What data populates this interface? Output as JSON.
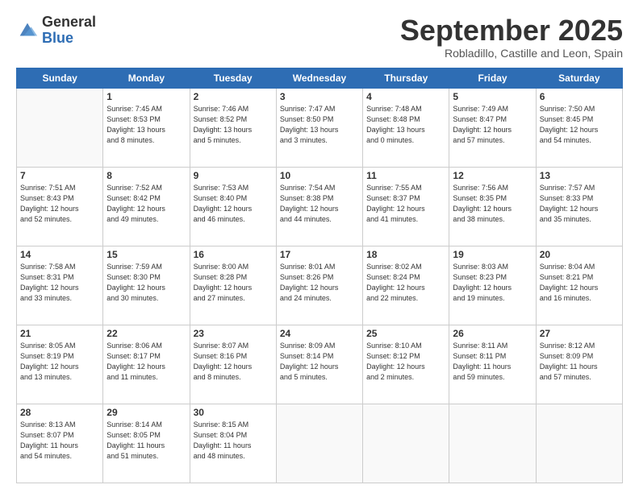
{
  "logo": {
    "general": "General",
    "blue": "Blue"
  },
  "title": "September 2025",
  "location": "Robladillo, Castille and Leon, Spain",
  "days_of_week": [
    "Sunday",
    "Monday",
    "Tuesday",
    "Wednesday",
    "Thursday",
    "Friday",
    "Saturday"
  ],
  "weeks": [
    [
      {
        "day": null,
        "info": null
      },
      {
        "day": "1",
        "info": "Sunrise: 7:45 AM\nSunset: 8:53 PM\nDaylight: 13 hours\nand 8 minutes."
      },
      {
        "day": "2",
        "info": "Sunrise: 7:46 AM\nSunset: 8:52 PM\nDaylight: 13 hours\nand 5 minutes."
      },
      {
        "day": "3",
        "info": "Sunrise: 7:47 AM\nSunset: 8:50 PM\nDaylight: 13 hours\nand 3 minutes."
      },
      {
        "day": "4",
        "info": "Sunrise: 7:48 AM\nSunset: 8:48 PM\nDaylight: 13 hours\nand 0 minutes."
      },
      {
        "day": "5",
        "info": "Sunrise: 7:49 AM\nSunset: 8:47 PM\nDaylight: 12 hours\nand 57 minutes."
      },
      {
        "day": "6",
        "info": "Sunrise: 7:50 AM\nSunset: 8:45 PM\nDaylight: 12 hours\nand 54 minutes."
      }
    ],
    [
      {
        "day": "7",
        "info": "Sunrise: 7:51 AM\nSunset: 8:43 PM\nDaylight: 12 hours\nand 52 minutes."
      },
      {
        "day": "8",
        "info": "Sunrise: 7:52 AM\nSunset: 8:42 PM\nDaylight: 12 hours\nand 49 minutes."
      },
      {
        "day": "9",
        "info": "Sunrise: 7:53 AM\nSunset: 8:40 PM\nDaylight: 12 hours\nand 46 minutes."
      },
      {
        "day": "10",
        "info": "Sunrise: 7:54 AM\nSunset: 8:38 PM\nDaylight: 12 hours\nand 44 minutes."
      },
      {
        "day": "11",
        "info": "Sunrise: 7:55 AM\nSunset: 8:37 PM\nDaylight: 12 hours\nand 41 minutes."
      },
      {
        "day": "12",
        "info": "Sunrise: 7:56 AM\nSunset: 8:35 PM\nDaylight: 12 hours\nand 38 minutes."
      },
      {
        "day": "13",
        "info": "Sunrise: 7:57 AM\nSunset: 8:33 PM\nDaylight: 12 hours\nand 35 minutes."
      }
    ],
    [
      {
        "day": "14",
        "info": "Sunrise: 7:58 AM\nSunset: 8:31 PM\nDaylight: 12 hours\nand 33 minutes."
      },
      {
        "day": "15",
        "info": "Sunrise: 7:59 AM\nSunset: 8:30 PM\nDaylight: 12 hours\nand 30 minutes."
      },
      {
        "day": "16",
        "info": "Sunrise: 8:00 AM\nSunset: 8:28 PM\nDaylight: 12 hours\nand 27 minutes."
      },
      {
        "day": "17",
        "info": "Sunrise: 8:01 AM\nSunset: 8:26 PM\nDaylight: 12 hours\nand 24 minutes."
      },
      {
        "day": "18",
        "info": "Sunrise: 8:02 AM\nSunset: 8:24 PM\nDaylight: 12 hours\nand 22 minutes."
      },
      {
        "day": "19",
        "info": "Sunrise: 8:03 AM\nSunset: 8:23 PM\nDaylight: 12 hours\nand 19 minutes."
      },
      {
        "day": "20",
        "info": "Sunrise: 8:04 AM\nSunset: 8:21 PM\nDaylight: 12 hours\nand 16 minutes."
      }
    ],
    [
      {
        "day": "21",
        "info": "Sunrise: 8:05 AM\nSunset: 8:19 PM\nDaylight: 12 hours\nand 13 minutes."
      },
      {
        "day": "22",
        "info": "Sunrise: 8:06 AM\nSunset: 8:17 PM\nDaylight: 12 hours\nand 11 minutes."
      },
      {
        "day": "23",
        "info": "Sunrise: 8:07 AM\nSunset: 8:16 PM\nDaylight: 12 hours\nand 8 minutes."
      },
      {
        "day": "24",
        "info": "Sunrise: 8:09 AM\nSunset: 8:14 PM\nDaylight: 12 hours\nand 5 minutes."
      },
      {
        "day": "25",
        "info": "Sunrise: 8:10 AM\nSunset: 8:12 PM\nDaylight: 12 hours\nand 2 minutes."
      },
      {
        "day": "26",
        "info": "Sunrise: 8:11 AM\nSunset: 8:11 PM\nDaylight: 11 hours\nand 59 minutes."
      },
      {
        "day": "27",
        "info": "Sunrise: 8:12 AM\nSunset: 8:09 PM\nDaylight: 11 hours\nand 57 minutes."
      }
    ],
    [
      {
        "day": "28",
        "info": "Sunrise: 8:13 AM\nSunset: 8:07 PM\nDaylight: 11 hours\nand 54 minutes."
      },
      {
        "day": "29",
        "info": "Sunrise: 8:14 AM\nSunset: 8:05 PM\nDaylight: 11 hours\nand 51 minutes."
      },
      {
        "day": "30",
        "info": "Sunrise: 8:15 AM\nSunset: 8:04 PM\nDaylight: 11 hours\nand 48 minutes."
      },
      {
        "day": null,
        "info": null
      },
      {
        "day": null,
        "info": null
      },
      {
        "day": null,
        "info": null
      },
      {
        "day": null,
        "info": null
      }
    ]
  ]
}
